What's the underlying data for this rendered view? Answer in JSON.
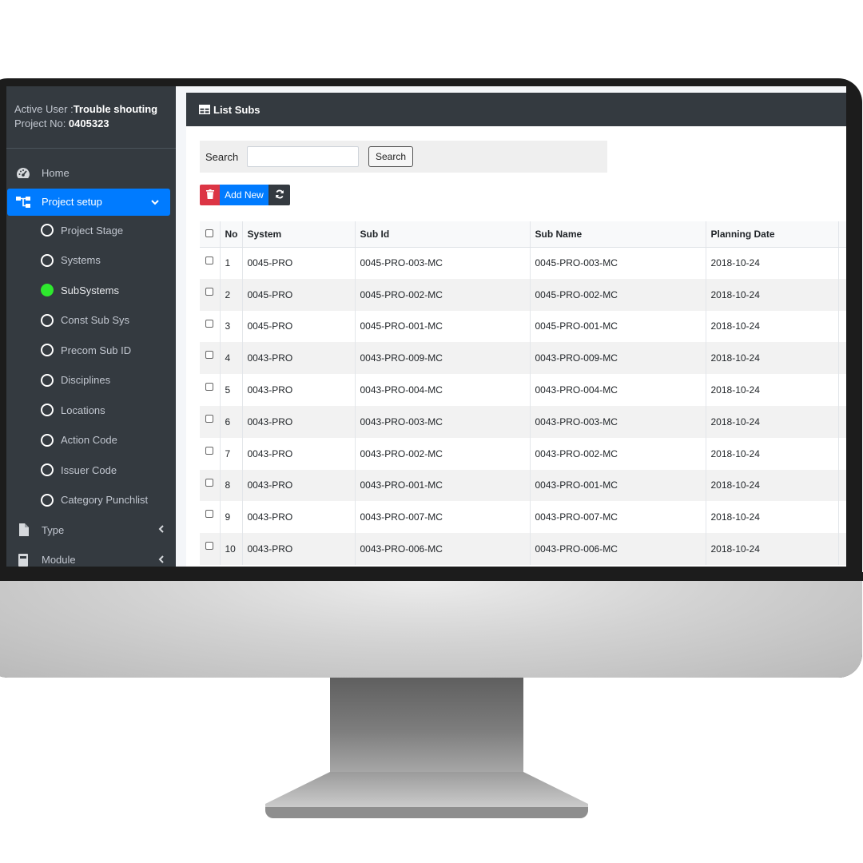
{
  "user_panel": {
    "active_user_label": "Active User :",
    "active_user_name": "Trouble shouting",
    "project_no_label": "Project No: ",
    "project_no": "0405323"
  },
  "nav": {
    "home": "Home",
    "project_setup": "Project setup",
    "sub_items": [
      "Project Stage",
      "Systems",
      "SubSystems",
      "Const Sub Sys",
      "Precom Sub ID",
      "Disciplines",
      "Locations",
      "Action Code",
      "Issuer Code",
      "Category Punchlist"
    ],
    "current_sub_item": "SubSystems",
    "type": "Type",
    "module": "Module"
  },
  "card": {
    "title": "List Subs"
  },
  "search": {
    "label": "Search",
    "value": "",
    "button": "Search"
  },
  "toolbar": {
    "add_new": "Add New"
  },
  "table": {
    "columns": [
      "No",
      "System",
      "Sub Id",
      "Sub Name",
      "Planning Date"
    ],
    "rows": [
      {
        "no": "1",
        "system": "0045-PRO",
        "sub_id": "0045-PRO-003-MC",
        "sub_name": "0045-PRO-003-MC",
        "planning_date": "2018-10-24"
      },
      {
        "no": "2",
        "system": "0045-PRO",
        "sub_id": "0045-PRO-002-MC",
        "sub_name": "0045-PRO-002-MC",
        "planning_date": "2018-10-24"
      },
      {
        "no": "3",
        "system": "0045-PRO",
        "sub_id": "0045-PRO-001-MC",
        "sub_name": "0045-PRO-001-MC",
        "planning_date": "2018-10-24"
      },
      {
        "no": "4",
        "system": "0043-PRO",
        "sub_id": "0043-PRO-009-MC",
        "sub_name": "0043-PRO-009-MC",
        "planning_date": "2018-10-24"
      },
      {
        "no": "5",
        "system": "0043-PRO",
        "sub_id": "0043-PRO-004-MC",
        "sub_name": "0043-PRO-004-MC",
        "planning_date": "2018-10-24"
      },
      {
        "no": "6",
        "system": "0043-PRO",
        "sub_id": "0043-PRO-003-MC",
        "sub_name": "0043-PRO-003-MC",
        "planning_date": "2018-10-24"
      },
      {
        "no": "7",
        "system": "0043-PRO",
        "sub_id": "0043-PRO-002-MC",
        "sub_name": "0043-PRO-002-MC",
        "planning_date": "2018-10-24"
      },
      {
        "no": "8",
        "system": "0043-PRO",
        "sub_id": "0043-PRO-001-MC",
        "sub_name": "0043-PRO-001-MC",
        "planning_date": "2018-10-24"
      },
      {
        "no": "9",
        "system": "0043-PRO",
        "sub_id": "0043-PRO-007-MC",
        "sub_name": "0043-PRO-007-MC",
        "planning_date": "2018-10-24"
      },
      {
        "no": "10",
        "system": "0043-PRO",
        "sub_id": "0043-PRO-006-MC",
        "sub_name": "0043-PRO-006-MC",
        "planning_date": "2018-10-24"
      }
    ]
  },
  "colors": {
    "sidebar_bg": "#343a40",
    "accent_blue": "#007bff",
    "danger_red": "#dc3545",
    "active_dot": "#2ee82e"
  },
  "icons": {
    "home": "dashboard-gauge-icon",
    "project_setup": "sitemap-icon",
    "type": "file-icon",
    "module": "book-icon",
    "card_title": "table-icon",
    "delete": "trash-icon",
    "refresh": "sync-icon"
  }
}
